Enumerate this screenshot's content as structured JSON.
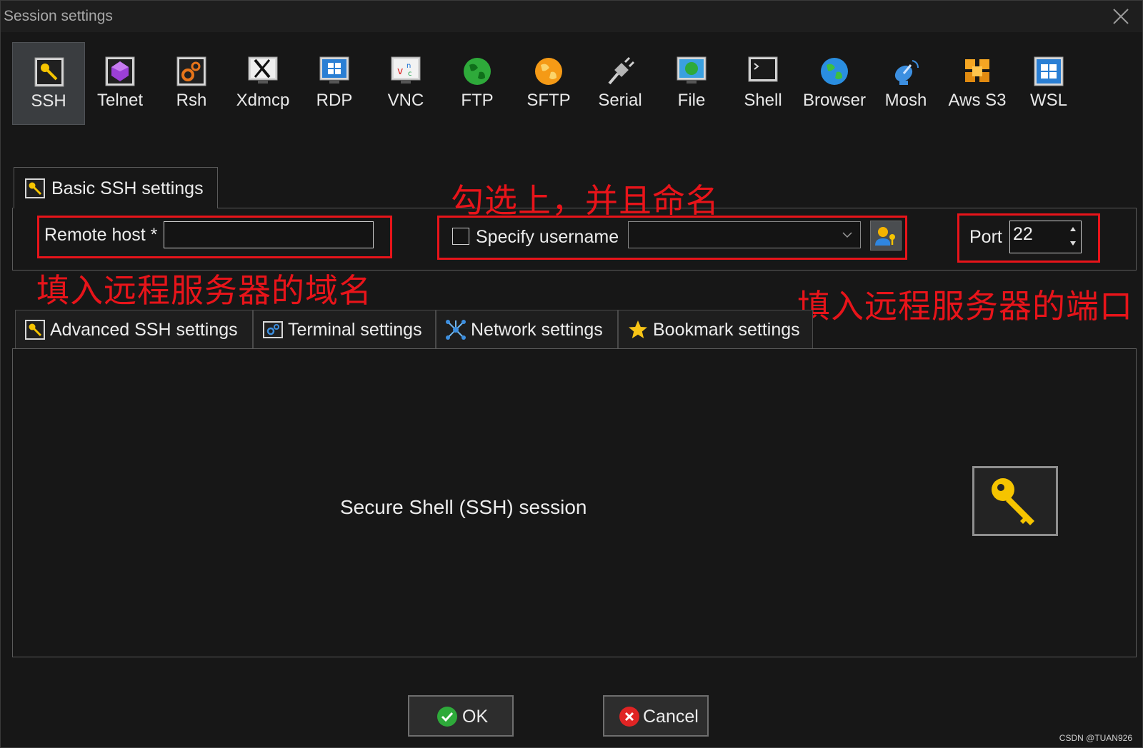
{
  "window": {
    "title": "Session settings"
  },
  "protocols": [
    {
      "label": "SSH",
      "icon": "ssh-key-icon",
      "selected": true
    },
    {
      "label": "Telnet",
      "icon": "telnet-gem-icon"
    },
    {
      "label": "Rsh",
      "icon": "rsh-gears-icon"
    },
    {
      "label": "Xdmcp",
      "icon": "xdmcp-x-icon"
    },
    {
      "label": "RDP",
      "icon": "rdp-windows-icon"
    },
    {
      "label": "VNC",
      "icon": "vnc-monitor-icon"
    },
    {
      "label": "FTP",
      "icon": "ftp-globe-icon"
    },
    {
      "label": "SFTP",
      "icon": "sftp-globe-icon"
    },
    {
      "label": "Serial",
      "icon": "serial-plug-icon"
    },
    {
      "label": "File",
      "icon": "file-monitor-icon"
    },
    {
      "label": "Shell",
      "icon": "shell-terminal-icon"
    },
    {
      "label": "Browser",
      "icon": "browser-globe-icon"
    },
    {
      "label": "Mosh",
      "icon": "mosh-satellite-icon"
    },
    {
      "label": "Aws S3",
      "icon": "aws-s3-cubes-icon"
    },
    {
      "label": "WSL",
      "icon": "wsl-windows-icon"
    }
  ],
  "basic": {
    "tab_label": "Basic SSH settings",
    "remote_host_label": "Remote host *",
    "remote_host_value": "",
    "specify_username_label": "Specify username",
    "username_value": "",
    "port_label": "Port",
    "port_value": "22"
  },
  "annotations": {
    "check_and_name": "勾选上，并且命名",
    "enter_host": "填入远程服务器的域名",
    "enter_port": "填入远程服务器的端口"
  },
  "sub_tabs": [
    {
      "label": "Advanced SSH settings",
      "icon": "wrench-key-icon"
    },
    {
      "label": "Terminal settings",
      "icon": "terminal-gear-icon"
    },
    {
      "label": "Network settings",
      "icon": "network-star-icon"
    },
    {
      "label": "Bookmark settings",
      "icon": "star-icon"
    }
  ],
  "main": {
    "description": "Secure Shell (SSH) session"
  },
  "buttons": {
    "ok": "OK",
    "cancel": "Cancel"
  },
  "watermark": "CSDN @TUAN926",
  "colors": {
    "annotation_red": "#e8141a",
    "selected_tab": "#3a3d40",
    "background": "#171717"
  }
}
